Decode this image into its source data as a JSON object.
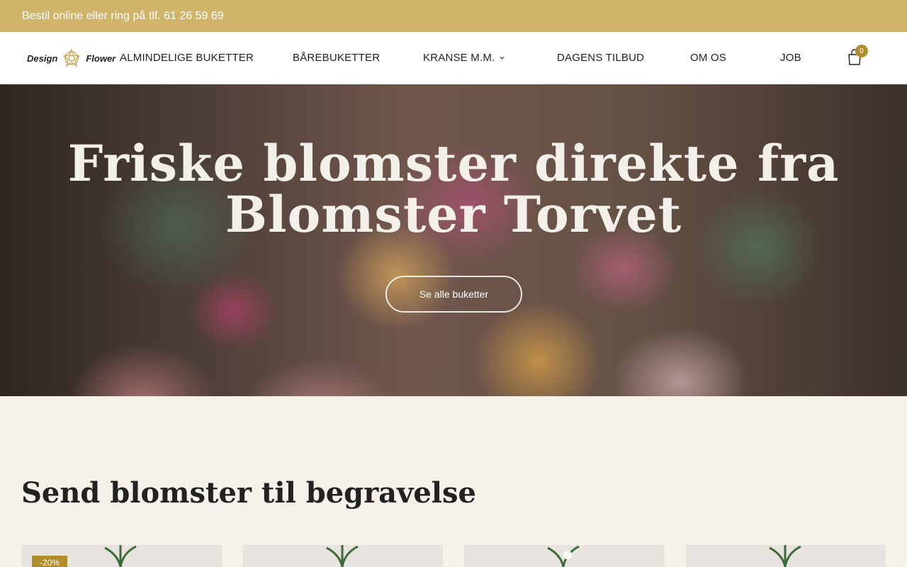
{
  "topbar": {
    "text": "Bestil online eller ring på tlf. 61 26 59 69"
  },
  "logo": {
    "word_left": "Design",
    "word_right": "Flower",
    "mark_icon": "flower-star-icon"
  },
  "nav": {
    "items": [
      {
        "label": "ALMINDELIGE BUKETTER"
      },
      {
        "label": "BÅREBUKETTER"
      },
      {
        "label": "KRANSE M.M.",
        "has_dropdown": true
      },
      {
        "label": "DAGENS TILBUD"
      },
      {
        "label": "OM OS"
      },
      {
        "label": "JOB"
      }
    ],
    "cart_count": "0",
    "cart_icon": "shopping-bag-icon"
  },
  "hero": {
    "title": "Friske blomster direkte fra Blomster Torvet",
    "button_label": "Se alle buketter"
  },
  "section": {
    "title": "Send blomster til begravelse"
  },
  "products": {
    "badge": "-20%"
  },
  "colors": {
    "topbar": "#d1b46a",
    "accent": "#b08c2a",
    "background": "#f6f1ea"
  }
}
